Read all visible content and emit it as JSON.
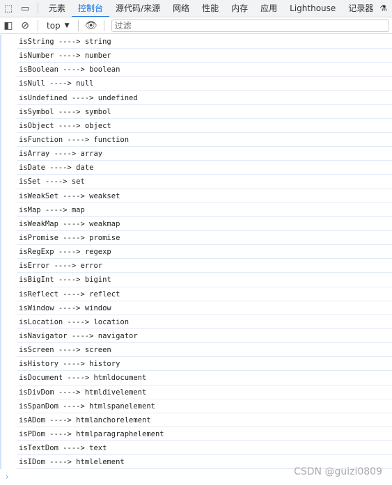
{
  "tabs": [
    "元素",
    "控制台",
    "源代码/来源",
    "网络",
    "性能",
    "内存",
    "应用",
    "Lighthouse",
    "记录器"
  ],
  "active_tab": "控制台",
  "toolbar": {
    "context": "top",
    "filter_placeholder": "过滤"
  },
  "logs": [
    "isString ----> string",
    "isNumber ----> number",
    "isBoolean ----> boolean",
    "isNull ----> null",
    "isUndefined ----> undefined",
    "isSymbol ----> symbol",
    "isObject ----> object",
    "isFunction ----> function",
    "isArray ----> array",
    "isDate ----> date",
    "isSet ----> set",
    "isWeakSet ----> weakset",
    "isMap ----> map",
    "isWeakMap ----> weakmap",
    "isPromise ----> promise",
    "isRegExp ----> regexp",
    "isError ----> error",
    "isBigInt ----> bigint",
    "isReflect ----> reflect",
    "isWindow ----> window",
    "isLocation ----> location",
    "isNavigator ----> navigator",
    "isScreen ----> screen",
    "isHistory ----> history",
    "isDocument ----> htmldocument",
    "isDivDom ----> htmldivelement",
    "isSpanDom ----> htmlspanelement",
    "isADom ----> htmlanchorelement",
    "isPDom ----> htmlparagraphelement",
    "isTextDom ----> text",
    "isIDom ----> htmlelement"
  ],
  "watermark": "CSDN @guizi0809",
  "accent": "#1a73e8"
}
